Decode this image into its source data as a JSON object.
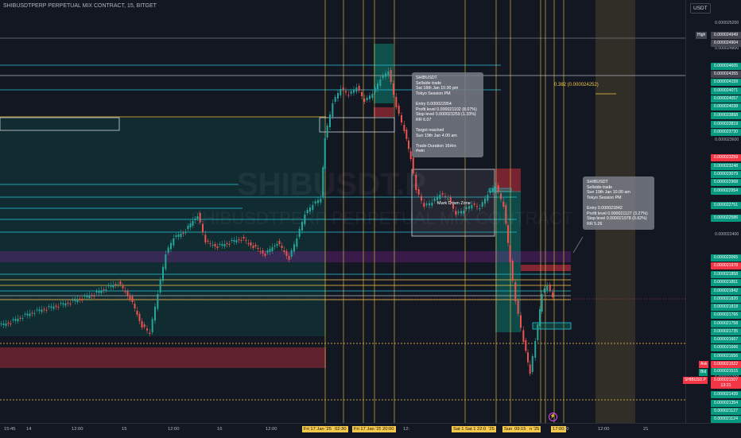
{
  "symbol_title": "SHIBUSDTPERP PERPETUAL MIX CONTRACT, 15, BITGET",
  "watermark": {
    "main": "SHIBUSDT.P",
    "sub": "SHIBUSDTPERP PERPETUAL MIX CONTRACT"
  },
  "currency": "USDT",
  "notes": [
    {
      "text": "SHIBUSDT\nSellside trade\nSat 18th Jan 10.00 pm\nTokyo Session PM\n\nEntry 0.000022954\nProfit level 0.000021102 (8.07%)\nStop level 0.000023259 (1.33%)\nRR 6.07\n\nTarget reached\nSun 19th Jan 4.00 am\n\nTrade Duration 16Hrs\n#win"
    },
    {
      "text": "SHIBUSDT\nSellside trade\nSun 19th Jan 10.00 am\nTokyo Session PM\n\nEntry 0.000021842\nProfit level 0.000021127 (3.27%)\nStop level 0.000021978 (0.62%)\nRR 5.26"
    }
  ],
  "fib_label": "0.382 (0.000024252)",
  "zone_label": "Mark Down Zone",
  "price_ticks": [
    "0.000025200",
    "0.000024800",
    "0.000023600",
    "0.000022400",
    "0.000021200"
  ],
  "price_labels": [
    {
      "text": "0.000024949",
      "color": "#434651"
    },
    {
      "text": "0.000024904",
      "color": "#434651"
    },
    {
      "text": "0.000024605",
      "color": "#089981"
    },
    {
      "text": "0.000024355",
      "color": "#434651"
    },
    {
      "text": "0.000024159",
      "color": "#089981"
    },
    {
      "text": "0.000024071",
      "color": "#089981"
    },
    {
      "text": "0.000024057",
      "color": "#089981"
    },
    {
      "text": "0.000024038",
      "color": "#089981"
    },
    {
      "text": "0.000023898",
      "color": "#089981"
    },
    {
      "text": "0.000023819",
      "color": "#089981"
    },
    {
      "text": "0.000023730",
      "color": "#089981"
    },
    {
      "text": "0.000023259",
      "color": "#f23645"
    },
    {
      "text": "0.000023248",
      "color": "#089981"
    },
    {
      "text": "0.000023079",
      "color": "#089981"
    },
    {
      "text": "0.000022968",
      "color": "#089981"
    },
    {
      "text": "0.000022954",
      "color": "#089981"
    },
    {
      "text": "0.000022751",
      "color": "#089981"
    },
    {
      "text": "0.000022586",
      "color": "#089981"
    },
    {
      "text": "0.000022065",
      "color": "#089981"
    },
    {
      "text": "0.000021978",
      "color": "#f23645"
    },
    {
      "text": "0.000021858",
      "color": "#089981"
    },
    {
      "text": "0.000021851",
      "color": "#089981"
    },
    {
      "text": "0.000021842",
      "color": "#089981"
    },
    {
      "text": "0.000021820",
      "color": "#089981"
    },
    {
      "text": "0.000021818",
      "color": "#089981"
    },
    {
      "text": "0.000021766",
      "color": "#089981"
    },
    {
      "text": "0.000021758",
      "color": "#089981"
    },
    {
      "text": "0.000021735",
      "color": "#089981"
    },
    {
      "text": "0.000021667",
      "color": "#089981"
    },
    {
      "text": "0.000021666",
      "color": "#089981"
    },
    {
      "text": "0.000021656",
      "color": "#089981"
    },
    {
      "text": "0.000021522",
      "color": "#f23645"
    },
    {
      "text": "0.000021515",
      "color": "#089981"
    },
    {
      "text": "0.000021507",
      "color": "#f23645"
    },
    {
      "text": "13:21",
      "color": "#f23645"
    },
    {
      "text": "0.000021439",
      "color": "#089981"
    },
    {
      "text": "0.000021354",
      "color": "#089981"
    },
    {
      "text": "0.000021127",
      "color": "#089981"
    },
    {
      "text": "0.000021124",
      "color": "#089981"
    }
  ],
  "side_tags": {
    "high": "High",
    "ask": "Ask",
    "bid": "Bid",
    "symbol": "SHIBUSD.P"
  },
  "time_labels": [
    {
      "text": "15:45",
      "hl": false
    },
    {
      "text": "14",
      "hl": false
    },
    {
      "text": "12:00",
      "hl": false
    },
    {
      "text": "15",
      "hl": false
    },
    {
      "text": "12:00",
      "hl": false
    },
    {
      "text": "16",
      "hl": false
    },
    {
      "text": "12:00",
      "hl": false
    },
    {
      "text": "Fri 17 Jan '25",
      "hl": true
    },
    {
      "text": "02:30",
      "hl": true
    },
    {
      "text": "Fri 17 Jan '25",
      "hl": true
    },
    {
      "text": "20:00",
      "hl": true
    },
    {
      "text": "12:",
      "hl": false
    },
    {
      "text": "Sat 1",
      "hl": true
    },
    {
      "text": "Sat 18 Jan '25",
      "hl": true
    },
    {
      "text": "22:0",
      "hl": true
    },
    {
      "text": "Sun 19 Jan '25",
      "hl": true
    },
    {
      "text": "09:15",
      "hl": true
    },
    {
      "text": "n '25",
      "hl": true
    },
    {
      "text": "17:00",
      "hl": true
    },
    {
      "text": "20",
      "hl": false
    },
    {
      "text": "12:00",
      "hl": false
    },
    {
      "text": "21",
      "hl": false
    }
  ],
  "colors": {
    "bg": "#131722",
    "up": "#26a69a",
    "down": "#ef5350",
    "session": "#f7c948",
    "zone_green": "#089981",
    "zone_red": "#f23645"
  }
}
